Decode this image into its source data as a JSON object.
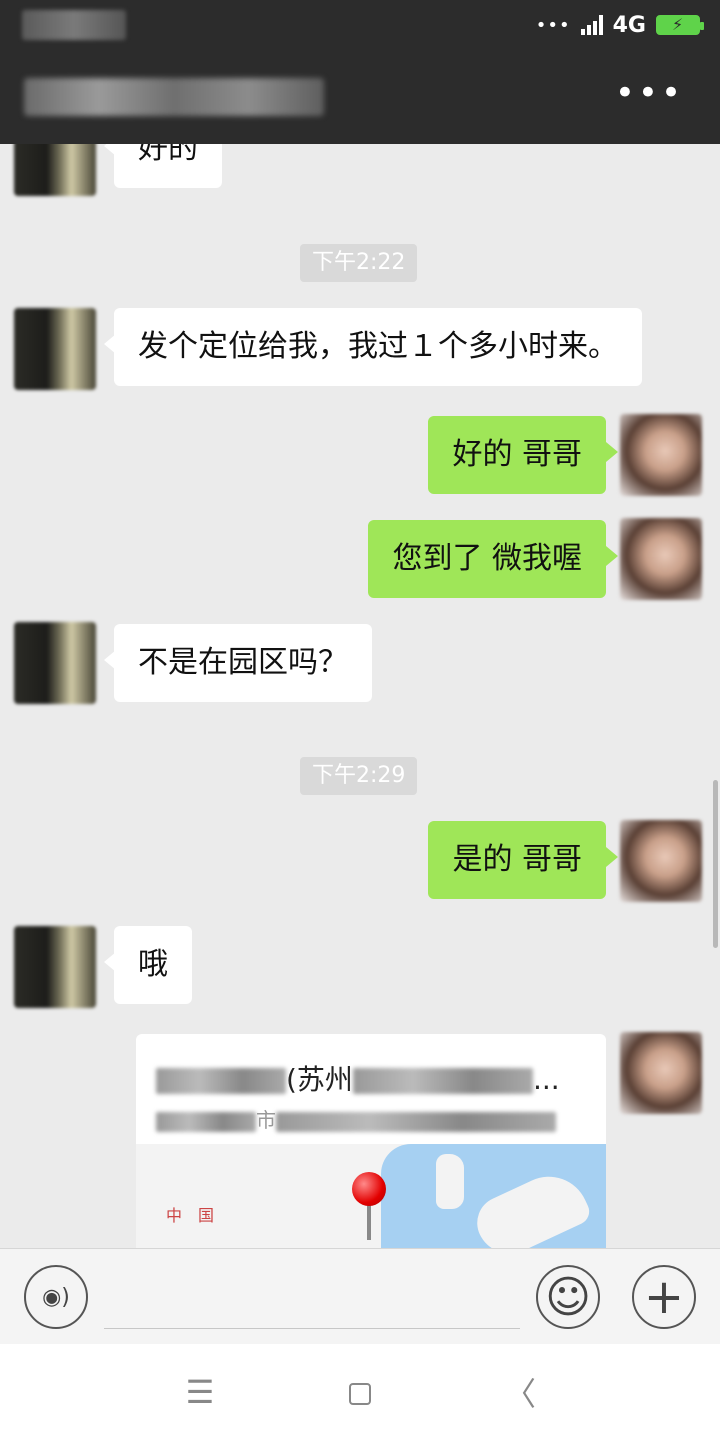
{
  "status": {
    "network": "4G"
  },
  "header": {
    "more_icon": "more-dots-icon"
  },
  "messages": {
    "m0": "好的",
    "t1": "下午2:22",
    "m1": "发个定位给我，我过１个多小时来。",
    "m2": "好的 哥哥",
    "m3": "您到了 微我喔",
    "m4": "不是在园区吗？",
    "t2": "下午2:29",
    "m5": "是的  哥哥",
    "m6": "哦"
  },
  "location": {
    "title_visible": "(苏州",
    "title_suffix": "...",
    "address_visible": "市",
    "map_label": "中国"
  },
  "input": {
    "placeholder": ""
  },
  "icons": {
    "voice": "voice-icon",
    "emoji": "emoji-icon",
    "plus": "plus-icon",
    "menu": "menu-icon",
    "home": "home-icon",
    "back": "back-icon"
  },
  "nav": {
    "menu": "☰",
    "back": "〈"
  },
  "colors": {
    "header_bg": "#2c2c2c",
    "chat_bg": "#ebebeb",
    "sent_bubble": "#9fe658",
    "received_bubble": "#ffffff"
  }
}
